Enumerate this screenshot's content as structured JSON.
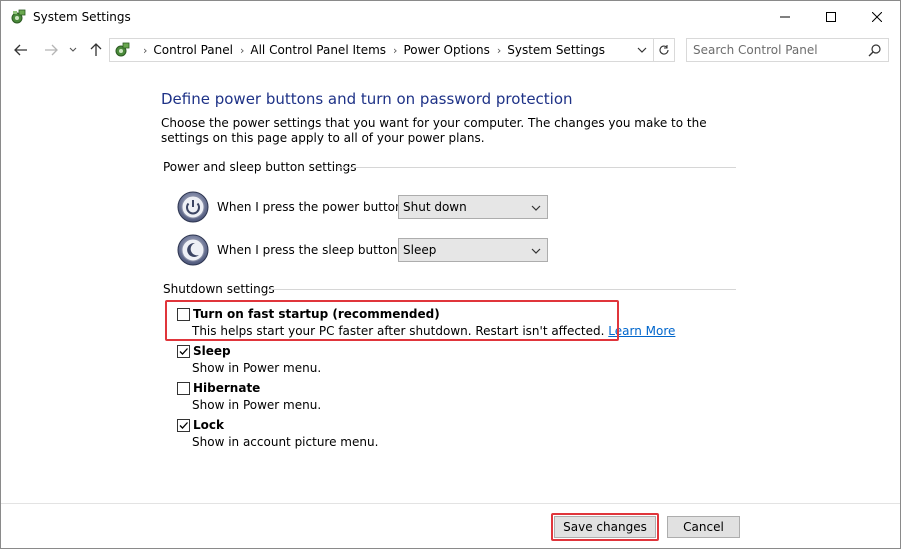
{
  "window": {
    "title": "System Settings",
    "controls": {
      "minimize": "minimize-icon",
      "maximize": "maximize-icon",
      "close": "close-icon"
    }
  },
  "navigation": {
    "breadcrumbs": [
      "Control Panel",
      "All Control Panel Items",
      "Power Options",
      "System Settings"
    ],
    "search_placeholder": "Search Control Panel"
  },
  "page": {
    "heading": "Define power buttons and turn on password protection",
    "intro": "Choose the power settings that you want for your computer. The changes you make to the settings on this page apply to all of your power plans."
  },
  "power_sleep": {
    "group_title": "Power and sleep button settings",
    "power_button": {
      "label": "When I press the power button:",
      "value": "Shut down",
      "icon": "power-button-icon"
    },
    "sleep_button": {
      "label": "When I press the sleep button:",
      "value": "Sleep",
      "icon": "sleep-button-icon"
    }
  },
  "shutdown": {
    "group_title": "Shutdown settings",
    "options": [
      {
        "title": "Turn on fast startup (recommended)",
        "description": "This helps start your PC faster after shutdown. Restart isn't affected.",
        "link": "Learn More",
        "checked": false,
        "highlighted": true
      },
      {
        "title": "Sleep",
        "description": "Show in Power menu.",
        "checked": true
      },
      {
        "title": "Hibernate",
        "description": "Show in Power menu.",
        "checked": false
      },
      {
        "title": "Lock",
        "description": "Show in account picture menu.",
        "checked": true
      }
    ]
  },
  "footer": {
    "save_label": "Save changes",
    "cancel_label": "Cancel"
  },
  "colors": {
    "heading": "#1e3287",
    "link": "#0066cc",
    "highlight": "#e0353b"
  }
}
